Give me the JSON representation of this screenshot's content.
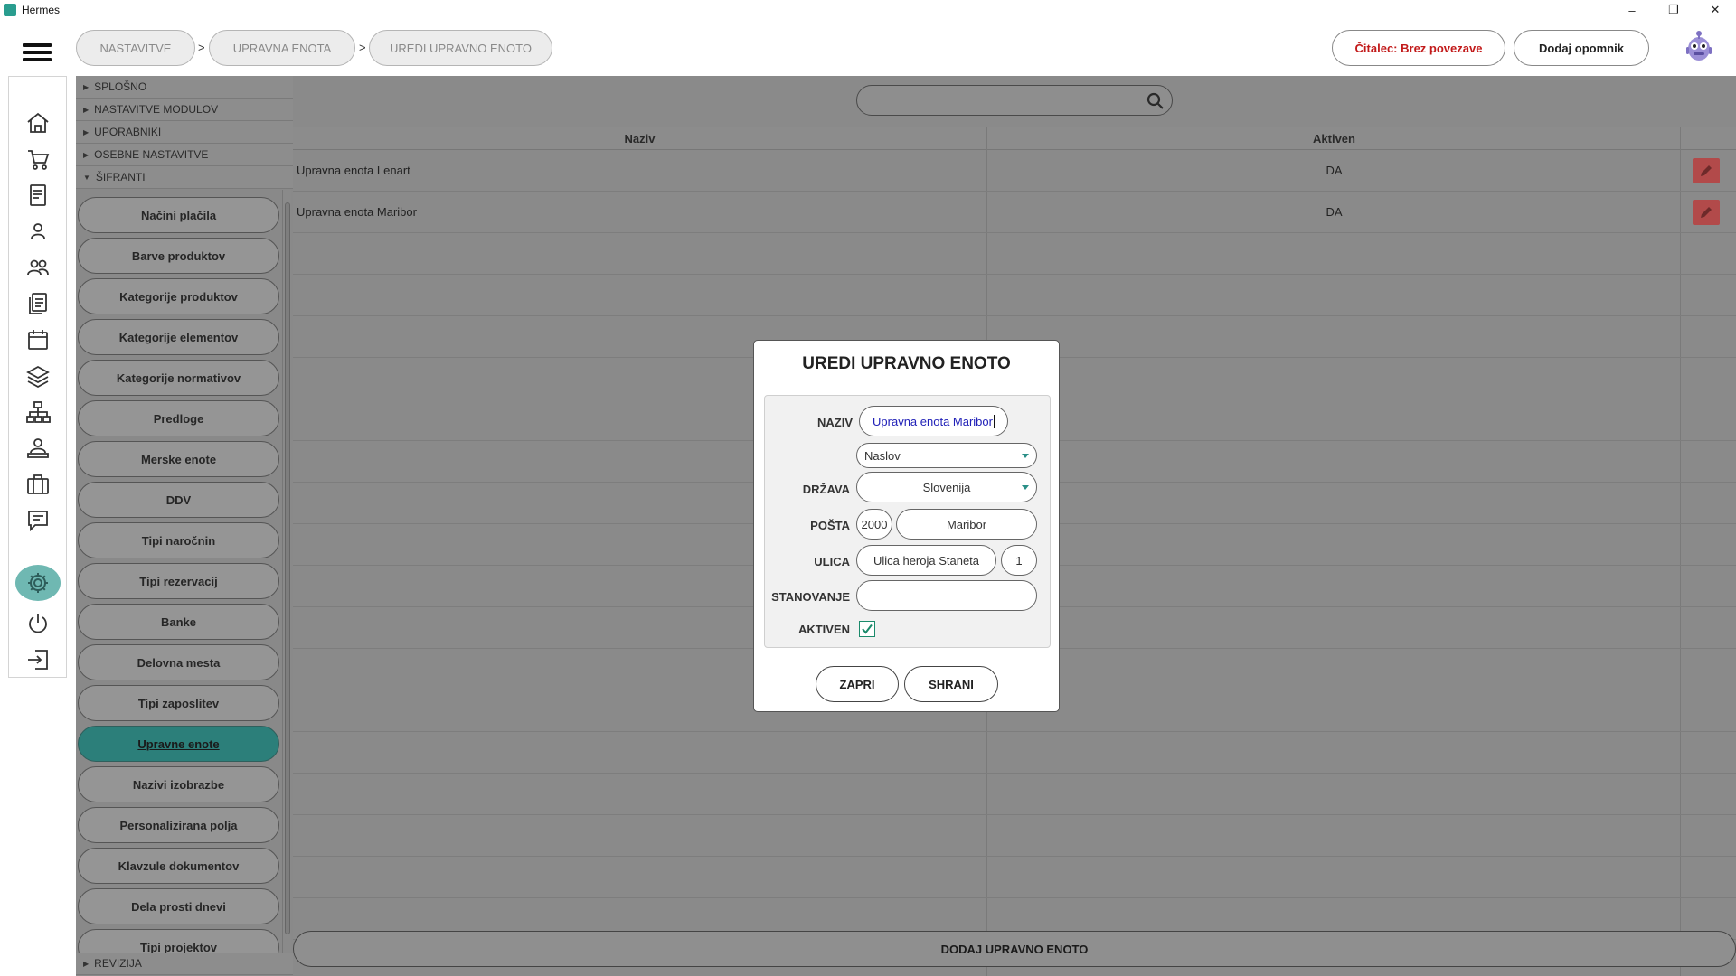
{
  "window": {
    "title": "Hermes",
    "controls": [
      "–",
      "❐",
      "✕"
    ]
  },
  "breadcrumb": {
    "items": [
      "NASTAVITVE",
      "UPRAVNA ENOTA",
      "UREDI UPRAVNO ENOTO"
    ],
    "separator": ">"
  },
  "header": {
    "reader_status": "Čitalec: Brez povezave",
    "add_reminder": "Dodaj opomnik"
  },
  "sidebar_icons": [
    "home-icon",
    "cart-icon",
    "document-icon",
    "person-icon",
    "people-icon",
    "documents-icon",
    "calendar-icon",
    "layers-icon",
    "hierarchy-icon",
    "user-desk-icon",
    "briefcase-icon",
    "chat-icon",
    "gear-icon",
    "power-icon",
    "logout-icon"
  ],
  "nav": {
    "sections": [
      "SPLOŠNO",
      "NASTAVITVE MODULOV",
      "UPORABNIKI",
      "OSEBNE NASTAVITVE",
      "ŠIFRANTI"
    ],
    "items": [
      "Načini plačila",
      "Barve produktov",
      "Kategorije produktov",
      "Kategorije elementov",
      "Kategorije normativov",
      "Predloge",
      "Merske enote",
      "DDV",
      "Tipi naročnin",
      "Tipi rezervacij",
      "Banke",
      "Delovna mesta",
      "Tipi zaposlitev",
      "Upravne enote",
      "Nazivi izobrazbe",
      "Personalizirana polja",
      "Klavzule dokumentov",
      "Dela prosti dnevi",
      "Tipi projektov"
    ],
    "active_item": "Upravne enote",
    "bottom_section": "REVIZIJA"
  },
  "table": {
    "search_value": "",
    "columns": [
      "Naziv",
      "Aktiven"
    ],
    "rows": [
      {
        "naziv": "Upravna enota Lenart",
        "aktiven": "DA"
      },
      {
        "naziv": "Upravna enota Maribor",
        "aktiven": "DA"
      }
    ],
    "add_button": "DODAJ UPRAVNO ENOTO"
  },
  "modal": {
    "title": "UREDI UPRAVNO ENOTO",
    "labels": {
      "naziv": "NAZIV",
      "drzava": "DRŽAVA",
      "posta": "POŠTA",
      "ulica": "ULICA",
      "stanovanje": "STANOVANJE",
      "aktiven": "AKTIVEN"
    },
    "values": {
      "naziv": "Upravna enota Maribor",
      "address_type": "Naslov",
      "drzava": "Slovenija",
      "postal_code": "2000",
      "city": "Maribor",
      "street": "Ulica heroja Staneta",
      "house_number": "1",
      "stanovanje": "",
      "aktiven": true
    },
    "buttons": {
      "close": "ZAPRI",
      "save": "SHRANI"
    }
  },
  "colors": {
    "active_nav": "#2c7f7a",
    "edit_button": "#b24a4a",
    "reader_status_text": "#c21a1a",
    "checkbox": "#1b8a6b"
  }
}
